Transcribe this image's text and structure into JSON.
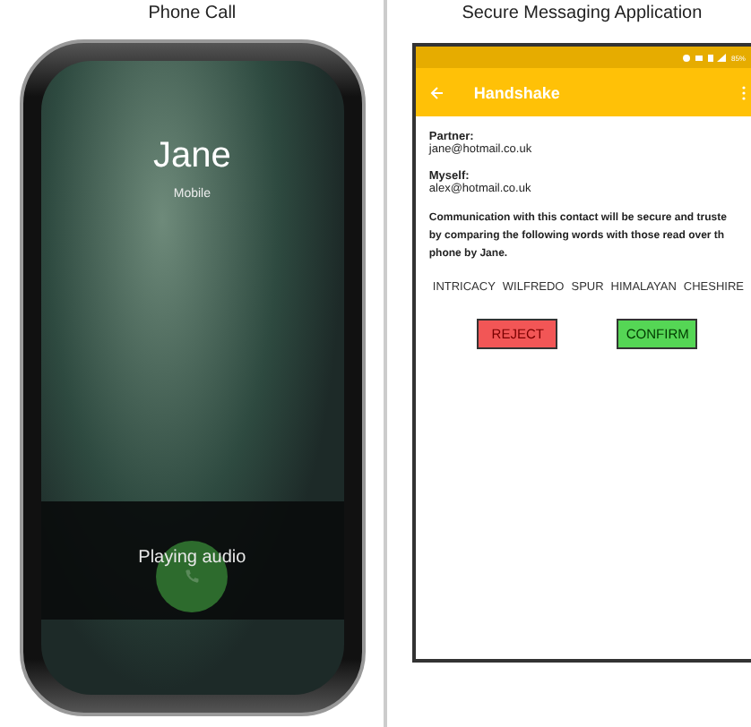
{
  "left_panel": {
    "title": "Phone Call",
    "caller": {
      "name": "Jane",
      "type": "Mobile"
    },
    "status": "Playing audio"
  },
  "right_panel": {
    "title": "Secure Messaging Application",
    "status_bar": {
      "battery": "85%"
    },
    "app_bar": {
      "title": "Handshake"
    },
    "fields": [
      {
        "label": "Partner:",
        "value": "jane@hotmail.co.uk"
      },
      {
        "label": "Myself:",
        "value": "alex@hotmail.co.uk"
      }
    ],
    "message": "Communication with this contact will be secure and truste\nby comparing the following words with those read over th\nphone by Jane.",
    "words": [
      "INTRICACY",
      "WILFREDO",
      "SPUR",
      "HIMALAYAN",
      "CHESHIRE"
    ],
    "buttons": [
      {
        "kind": "reject",
        "label": "REJECT"
      },
      {
        "kind": "confirm",
        "label": "CONFIRM"
      }
    ]
  }
}
